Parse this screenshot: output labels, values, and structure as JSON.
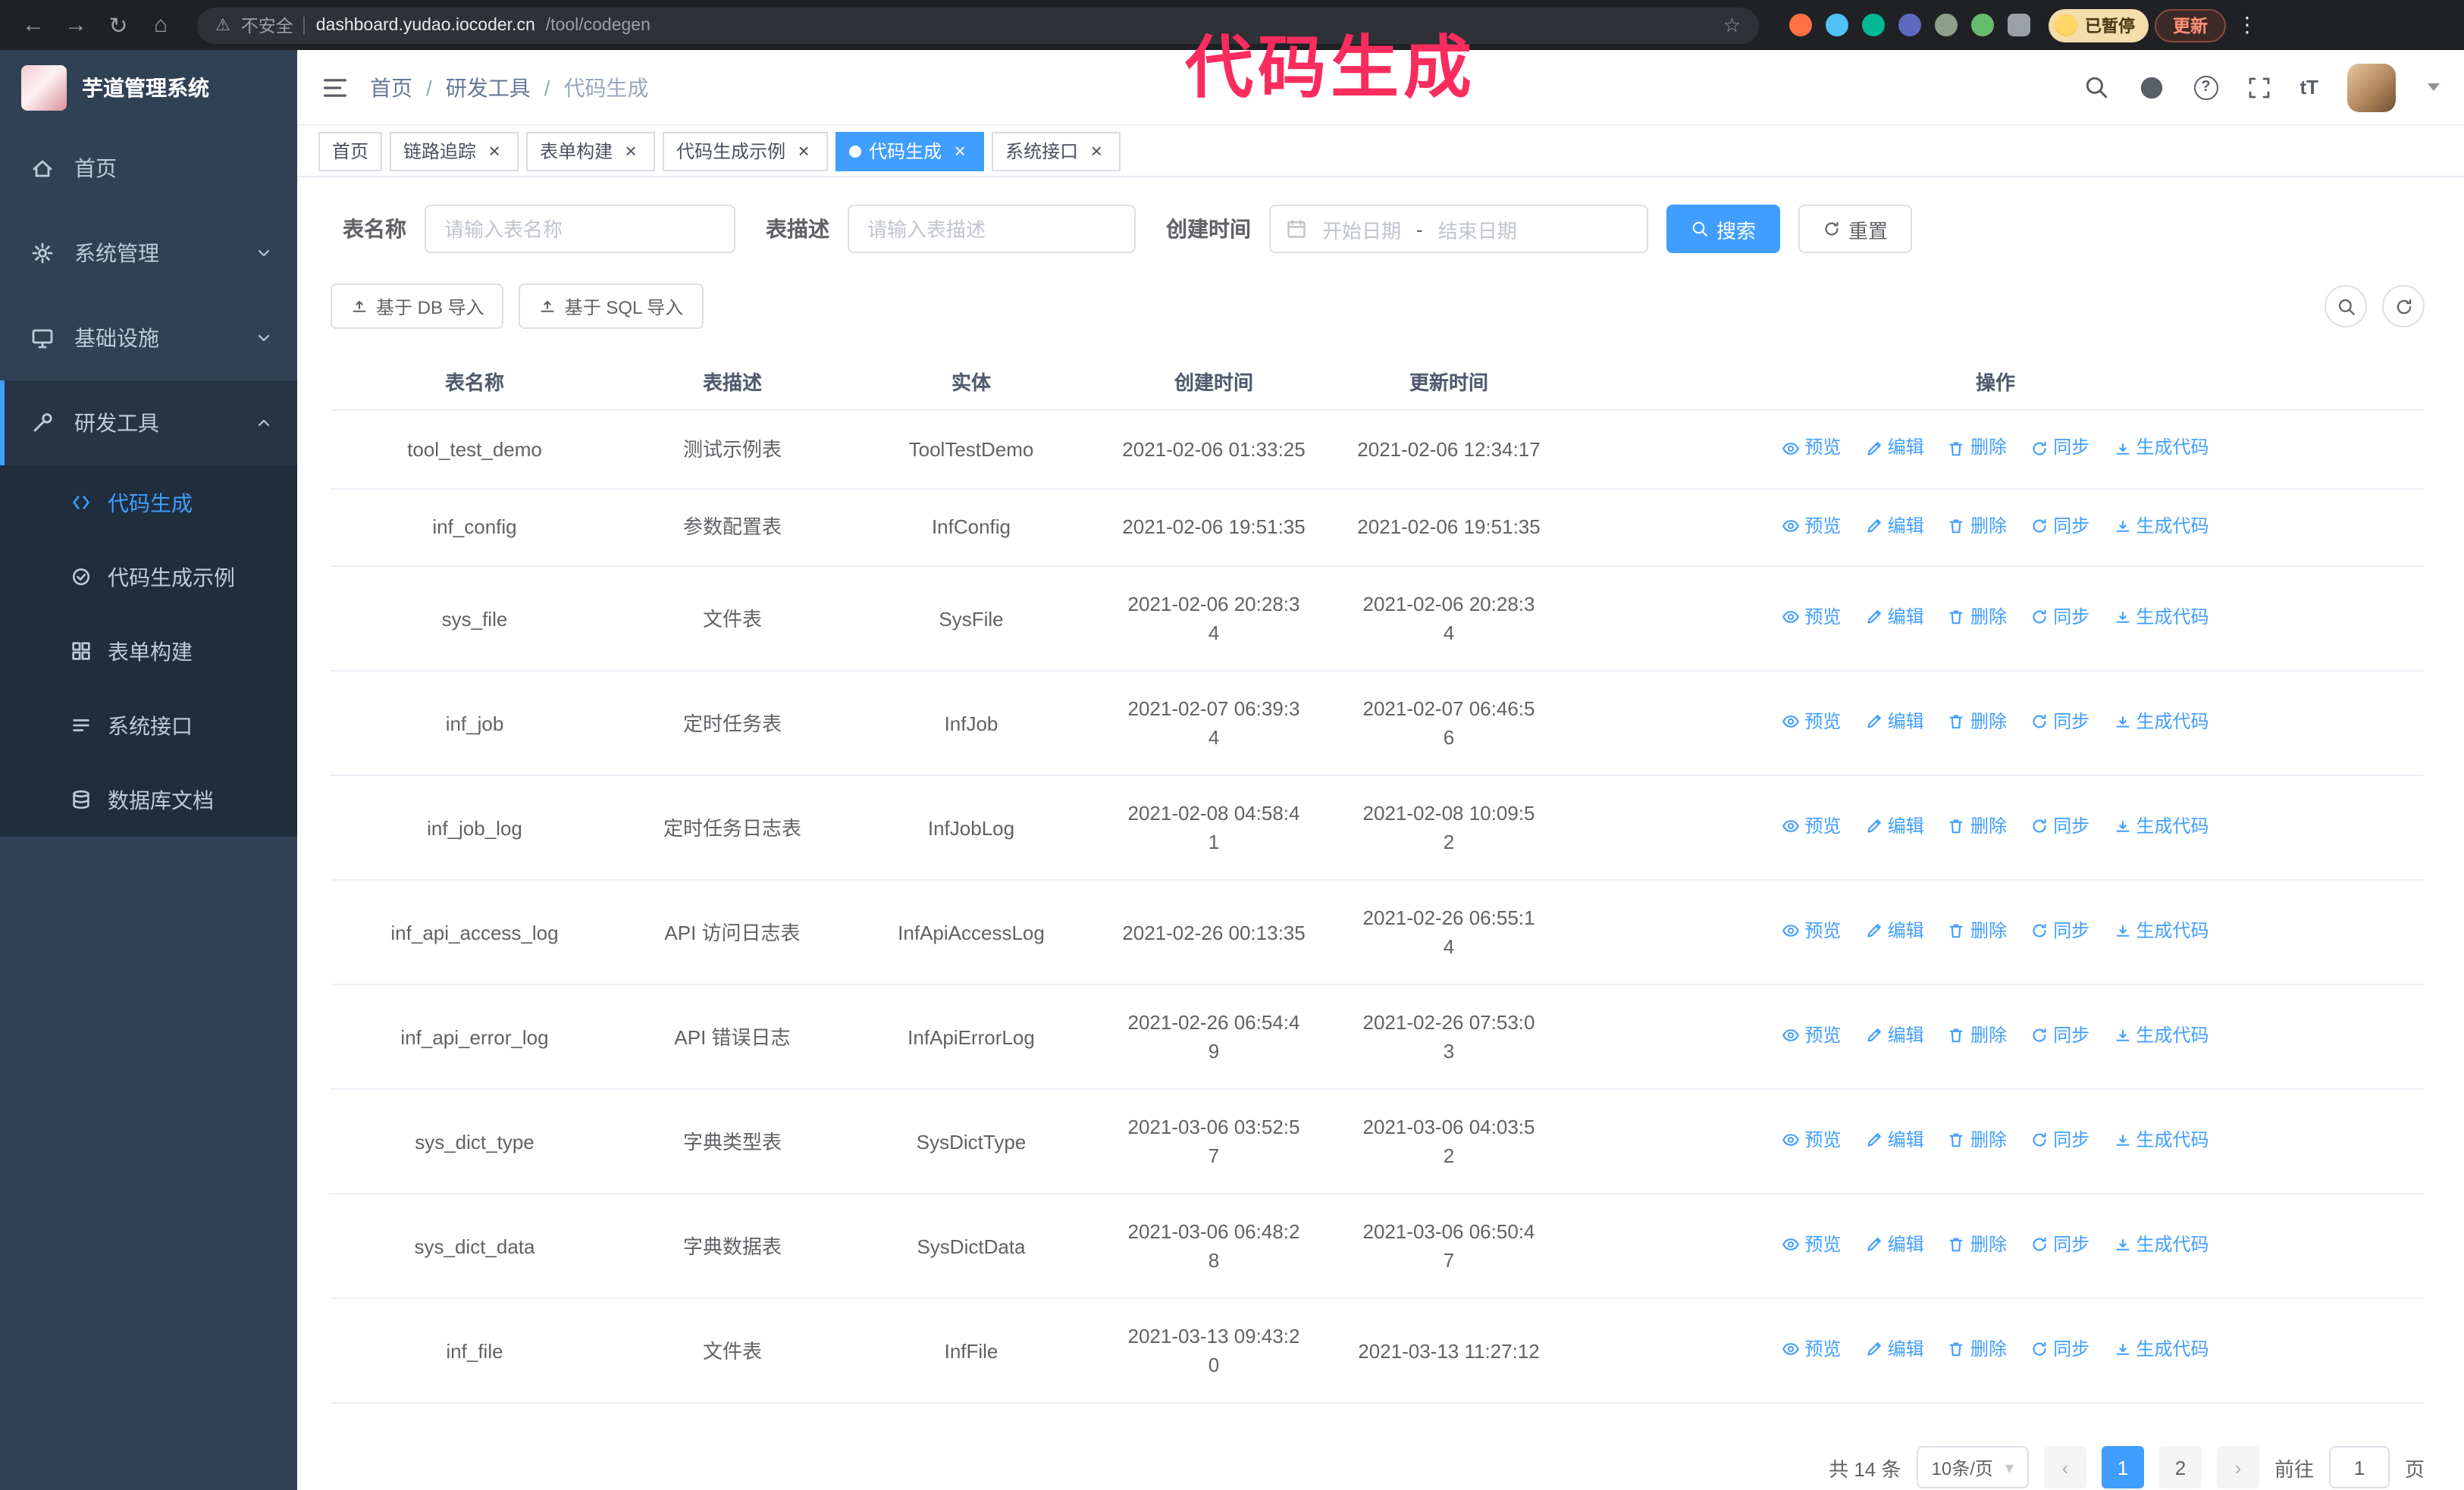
{
  "annotation": {
    "text": "代码生成"
  },
  "chrome": {
    "security_label": "不安全",
    "url_host": "dashboard.yudao.iocoder.cn",
    "url_path": "/tool/codegen",
    "paused_badge": "已暂停",
    "update_button": "更新"
  },
  "icons": {
    "back": "←",
    "forward": "→",
    "reload": "↻",
    "home": "⌂",
    "warning": "⚠",
    "star": "☆",
    "kebab": "⋮",
    "close": "×",
    "question": "?",
    "font_size": "tT",
    "breadcrumb_separator": "/",
    "date_separator": "-",
    "select_caret": "▾",
    "arrow_left": "‹",
    "arrow_right": "›"
  },
  "navbar": {
    "breadcrumb": [
      "首页",
      "研发工具",
      "代码生成"
    ]
  },
  "sidebar": {
    "logo_title": "芋道管理系统",
    "items": [
      {
        "label": "首页"
      },
      {
        "label": "系统管理"
      },
      {
        "label": "基础设施"
      },
      {
        "label": "研发工具"
      }
    ],
    "dev_tools_children": [
      {
        "label": "代码生成"
      },
      {
        "label": "代码生成示例"
      },
      {
        "label": "表单构建"
      },
      {
        "label": "系统接口"
      },
      {
        "label": "数据库文档"
      }
    ]
  },
  "tags": [
    {
      "label": "首页"
    },
    {
      "label": "链路追踪"
    },
    {
      "label": "表单构建"
    },
    {
      "label": "代码生成示例"
    },
    {
      "label": "代码生成"
    },
    {
      "label": "系统接口"
    }
  ],
  "filters": {
    "table_name_label": "表名称",
    "table_name_placeholder": "请输入表名称",
    "table_desc_label": "表描述",
    "table_desc_placeholder": "请输入表描述",
    "create_time_label": "创建时间",
    "date_start_placeholder": "开始日期",
    "date_end_placeholder": "结束日期",
    "search_label": "搜索",
    "reset_label": "重置"
  },
  "toolbar": {
    "import_db_label": "基于 DB 导入",
    "import_sql_label": "基于 SQL 导入"
  },
  "table": {
    "columns": [
      "表名称",
      "表描述",
      "实体",
      "创建时间",
      "更新时间",
      "操作"
    ],
    "ops": [
      "预览",
      "编辑",
      "删除",
      "同步",
      "生成代码"
    ],
    "rows": [
      {
        "name": "tool_test_demo",
        "desc": "测试示例表",
        "entity": "ToolTestDemo",
        "created": "2021-02-06 01:33:25",
        "updated": "2021-02-06 12:34:17"
      },
      {
        "name": "inf_config",
        "desc": "参数配置表",
        "entity": "InfConfig",
        "created": "2021-02-06 19:51:35",
        "updated": "2021-02-06 19:51:35"
      },
      {
        "name": "sys_file",
        "desc": "文件表",
        "entity": "SysFile",
        "created": "2021-02-06 20:28:3\n4",
        "updated": "2021-02-06 20:28:3\n4"
      },
      {
        "name": "inf_job",
        "desc": "定时任务表",
        "entity": "InfJob",
        "created": "2021-02-07 06:39:3\n4",
        "updated": "2021-02-07 06:46:5\n6"
      },
      {
        "name": "inf_job_log",
        "desc": "定时任务日志表",
        "entity": "InfJobLog",
        "created": "2021-02-08 04:58:4\n1",
        "updated": "2021-02-08 10:09:5\n2"
      },
      {
        "name": "inf_api_access_log",
        "desc": "API 访问日志表",
        "entity": "InfApiAccessLog",
        "created": "2021-02-26 00:13:35",
        "updated": "2021-02-26 06:55:1\n4"
      },
      {
        "name": "inf_api_error_log",
        "desc": "API 错误日志",
        "entity": "InfApiErrorLog",
        "created": "2021-02-26 06:54:4\n9",
        "updated": "2021-02-26 07:53:0\n3"
      },
      {
        "name": "sys_dict_type",
        "desc": "字典类型表",
        "entity": "SysDictType",
        "created": "2021-03-06 03:52:5\n7",
        "updated": "2021-03-06 04:03:5\n2"
      },
      {
        "name": "sys_dict_data",
        "desc": "字典数据表",
        "entity": "SysDictData",
        "created": "2021-03-06 06:48:2\n8",
        "updated": "2021-03-06 06:50:4\n7"
      },
      {
        "name": "inf_file",
        "desc": "文件表",
        "entity": "InfFile",
        "created": "2021-03-13 09:43:2\n0",
        "updated": "2021-03-13 11:27:12"
      }
    ]
  },
  "pagination": {
    "total": "共 14 条",
    "page_size": "10条/页",
    "pages": [
      "1",
      "2"
    ],
    "goto_label": "前往",
    "goto_value": "1",
    "goto_suffix": "页"
  }
}
